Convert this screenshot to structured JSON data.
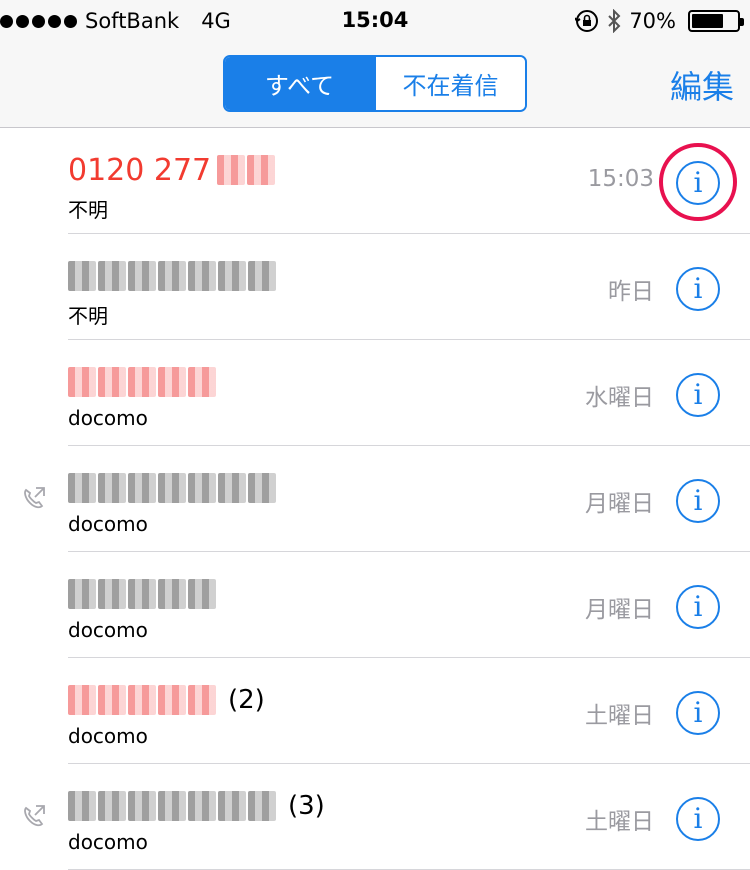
{
  "status_bar": {
    "carrier": "SoftBank",
    "network": "4G",
    "time": "15:04",
    "battery_percent": "70%",
    "battery_level": 0.7
  },
  "nav": {
    "segments": [
      "すべて",
      "不在着信"
    ],
    "selected_segment": "すべて",
    "edit_label": "編集"
  },
  "calls": [
    {
      "name": "0120 277",
      "sub": "不明",
      "time": "15:03",
      "missed": true,
      "outgoing": false,
      "count": "",
      "redacted": true,
      "highlighted": true
    },
    {
      "name": "",
      "sub": "不明",
      "time": "昨日",
      "missed": false,
      "outgoing": false,
      "count": "",
      "redacted": true,
      "highlighted": false
    },
    {
      "name": "",
      "sub": "docomo",
      "time": "水曜日",
      "missed": true,
      "outgoing": false,
      "count": "",
      "redacted": true,
      "highlighted": false
    },
    {
      "name": "",
      "sub": "docomo",
      "time": "月曜日",
      "missed": false,
      "outgoing": true,
      "count": "",
      "redacted": true,
      "highlighted": false
    },
    {
      "name": "",
      "sub": "docomo",
      "time": "月曜日",
      "missed": false,
      "outgoing": false,
      "count": "",
      "redacted": true,
      "highlighted": false
    },
    {
      "name": "",
      "sub": "docomo",
      "time": "土曜日",
      "missed": true,
      "outgoing": false,
      "count": "(2)",
      "redacted": true,
      "highlighted": false
    },
    {
      "name": "",
      "sub": "docomo",
      "time": "土曜日",
      "missed": false,
      "outgoing": true,
      "count": "(3)",
      "redacted": true,
      "highlighted": false
    }
  ],
  "colors": {
    "accent": "#1a7fe8",
    "missed": "#f23b30",
    "highlight_ring": "#e8114f",
    "secondary_text": "#9a9aa0"
  },
  "icons": {
    "info": "info-icon",
    "outgoing": "outgoing-call-icon",
    "lock": "rotation-lock-icon",
    "bluetooth": "bluetooth-icon",
    "battery": "battery-icon"
  }
}
